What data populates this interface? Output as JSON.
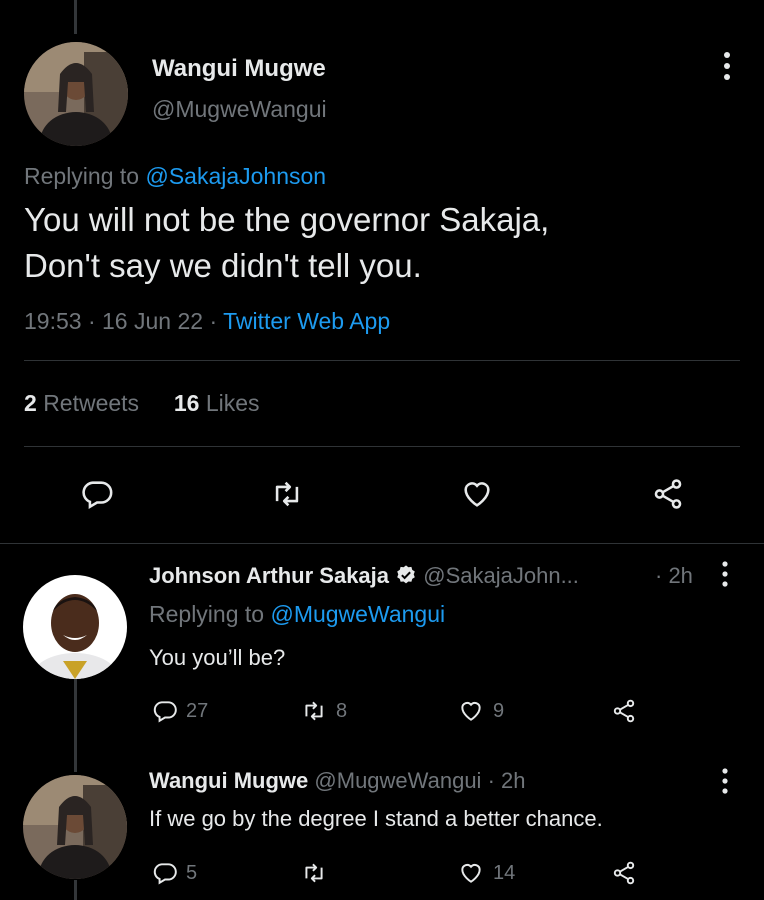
{
  "main_tweet": {
    "name": "Wangui Mugwe",
    "handle": "@MugweWangui",
    "replying_prefix": "Replying to ",
    "replying_to": "@SakajaJohnson",
    "text_line1": "You will not be the governor Sakaja,",
    "text_line2": "Don't say we didn't tell you.",
    "time": "19:53",
    "date": "16 Jun 22",
    "app": "Twitter Web App",
    "retweets_count": "2",
    "retweets_label": "Retweets",
    "likes_count": "16",
    "likes_label": "Likes",
    "actions": [
      "reply",
      "retweet",
      "like",
      "share"
    ]
  },
  "reply1": {
    "name": "Johnson Arthur Sakaja",
    "verified": true,
    "handle": "@SakajaJohn...",
    "time": "· 2h",
    "replying_prefix": "Replying to ",
    "replying_to": "@MugweWangui",
    "text": "You you’ll be?",
    "reply_count": "27",
    "retweet_count": "8",
    "like_count": "9"
  },
  "reply2": {
    "name": "Wangui Mugwe",
    "handle": "@MugweWangui",
    "time": "· 2h",
    "text": "If we go by the degree I stand a better chance.",
    "reply_count": "5",
    "retweet_count": "",
    "like_count": "14"
  },
  "colors": {
    "background": "#000000",
    "text_primary": "#e7e9ea",
    "text_secondary": "#71767b",
    "link": "#1d9bf0",
    "verified": "#e7e9ea",
    "divider": "#2f3336"
  }
}
